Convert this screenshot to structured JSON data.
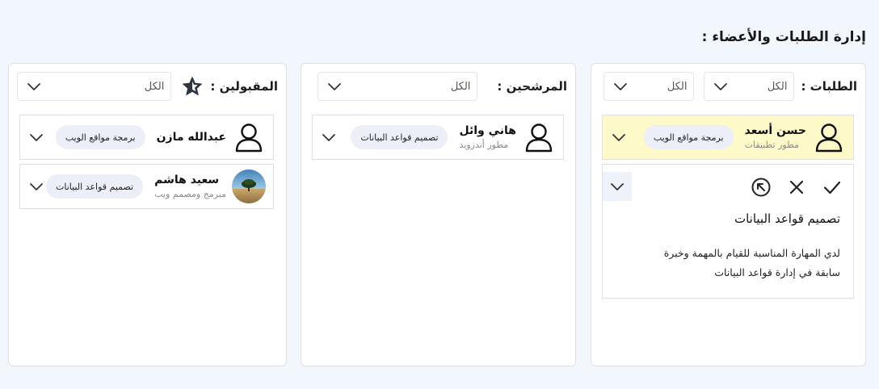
{
  "page": {
    "title": "إدارة الطلبات والأعضاء :"
  },
  "requests": {
    "title": "الطلبات :",
    "filter_all_1": "الكل",
    "filter_all_2": "الكل",
    "cards": [
      {
        "name": "حسن أسعد",
        "role": "مطور تطبيقات",
        "skill": "برمجة مواقع الويب",
        "avatar": "person-outline-icon"
      }
    ],
    "detail": {
      "title": "تصميم قواعد البيانات",
      "body": "لدي المهارة المناسبة للقيام بالمهمة وخبرة سابقة في إدارة قواعد البيانات"
    }
  },
  "candidates": {
    "title": "المرشحين :",
    "filter_all": "الكل",
    "cards": [
      {
        "name": "هاني وائل",
        "role": "مطور أندرويد",
        "skill": "تصميم قواعد البيانات",
        "avatar": "person-outline-icon"
      }
    ]
  },
  "accepted": {
    "title": "المقبولين :",
    "filter_all": "الكل",
    "star_icon": "star-icon",
    "cards": [
      {
        "name": "عبدالله مازن",
        "role": "",
        "skill": "برمجة مواقع الويب",
        "avatar": "person-outline-icon"
      },
      {
        "name": "سعيد هاشم",
        "role": "مبرمج ومصمم ويب",
        "skill": "تصميم قواعد البيانات",
        "avatar": "photo-avatar"
      }
    ]
  },
  "colors": {
    "background": "#f2f6fd",
    "highlight": "#fdf9c8",
    "chip": "#eceff7"
  }
}
